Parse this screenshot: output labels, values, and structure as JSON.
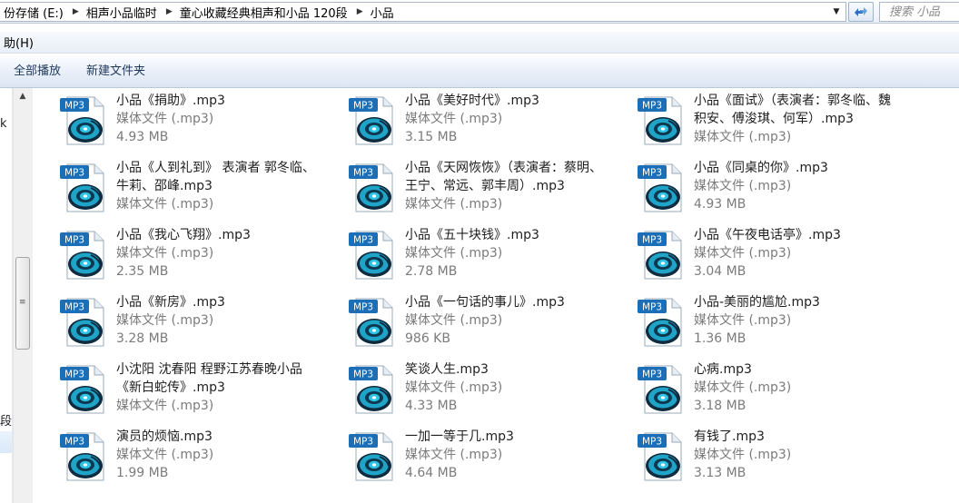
{
  "address_bar": {
    "crumbs": [
      "份存储 (E:)",
      "相声小品临时",
      "童心收藏经典相声和小品 120段",
      "小品"
    ],
    "search_placeholder": "搜索 小品"
  },
  "menu": {
    "items": [
      "助(H)"
    ]
  },
  "toolbar": {
    "play_all": "全部播放",
    "new_folder": "新建文件夹"
  },
  "nav_fragments": {
    "top": "k",
    "bottom": "段"
  },
  "file_icon_label": "MP3",
  "colors": {
    "icon_badge": "#1c6fb7",
    "icon_disc": "#1fa3c7",
    "secondary_text": "#7b7b7b"
  },
  "files": [
    {
      "name": "小品《捐助》.mp3",
      "type": "媒体文件 (.mp3)",
      "size": "4.93 MB"
    },
    {
      "name": "小品《美好时代》.mp3",
      "type": "媒体文件 (.mp3)",
      "size": "3.15 MB"
    },
    {
      "name": "小品《面试》（表演者：郭冬临、魏积安、傅浚琪、何军）.mp3",
      "type": "媒体文件 (.mp3)",
      "size": ""
    },
    {
      "name": "小品《人到礼到》 表演者 郭冬临、牛莉、邵峰.mp3",
      "type": "媒体文件 (.mp3)",
      "size": ""
    },
    {
      "name": "小品《天网恢恢》（表演者：蔡明、王宁、常远、郭丰周）.mp3",
      "type": "媒体文件 (.mp3)",
      "size": ""
    },
    {
      "name": "小品《同桌的你》.mp3",
      "type": "媒体文件 (.mp3)",
      "size": "4.93 MB"
    },
    {
      "name": "小品《我心飞翔》.mp3",
      "type": "媒体文件 (.mp3)",
      "size": "2.35 MB"
    },
    {
      "name": "小品《五十块钱》.mp3",
      "type": "媒体文件 (.mp3)",
      "size": "2.78 MB"
    },
    {
      "name": "小品《午夜电话亭》.mp3",
      "type": "媒体文件 (.mp3)",
      "size": "3.04 MB"
    },
    {
      "name": "小品《新房》.mp3",
      "type": "媒体文件 (.mp3)",
      "size": "3.28 MB"
    },
    {
      "name": "小品《一句话的事儿》.mp3",
      "type": "媒体文件 (.mp3)",
      "size": "986 KB"
    },
    {
      "name": "小品-美丽的尴尬.mp3",
      "type": "媒体文件 (.mp3)",
      "size": "1.36 MB"
    },
    {
      "name": "小沈阳 沈春阳 程野江苏春晚小品《新白蛇传》.mp3",
      "type": "媒体文件 (.mp3)",
      "size": ""
    },
    {
      "name": "笑谈人生.mp3",
      "type": "媒体文件 (.mp3)",
      "size": "4.33 MB"
    },
    {
      "name": "心病.mp3",
      "type": "媒体文件 (.mp3)",
      "size": "3.18 MB"
    },
    {
      "name": "演员的烦恼.mp3",
      "type": "媒体文件 (.mp3)",
      "size": "1.99 MB"
    },
    {
      "name": "一加一等于几.mp3",
      "type": "媒体文件 (.mp3)",
      "size": "4.64 MB"
    },
    {
      "name": "有钱了.mp3",
      "type": "媒体文件 (.mp3)",
      "size": "3.13 MB"
    }
  ]
}
